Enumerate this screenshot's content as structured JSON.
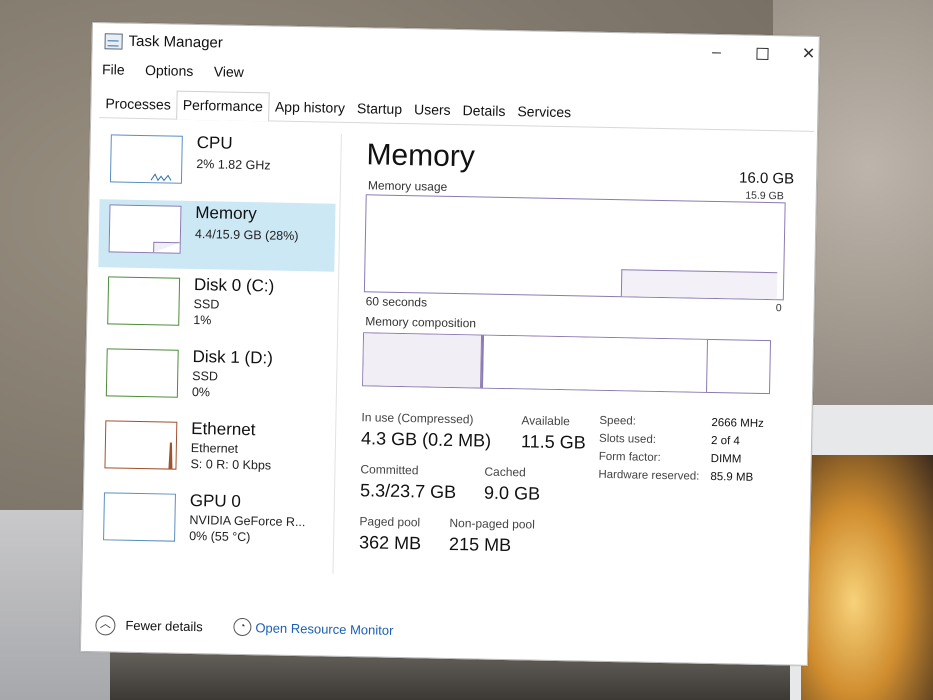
{
  "window": {
    "title": "Task Manager"
  },
  "menu": [
    "File",
    "Options",
    "View"
  ],
  "tabs": [
    "Processes",
    "Performance",
    "App history",
    "Startup",
    "Users",
    "Details",
    "Services"
  ],
  "active_tab": "Performance",
  "sidebar": [
    {
      "name": "CPU",
      "lines": [
        "2% 1.82 GHz"
      ]
    },
    {
      "name": "Memory",
      "lines": [
        "4.4/15.9 GB (28%)"
      ],
      "selected": true
    },
    {
      "name": "Disk 0 (C:)",
      "lines": [
        "SSD",
        "1%"
      ]
    },
    {
      "name": "Disk 1 (D:)",
      "lines": [
        "SSD",
        "0%"
      ]
    },
    {
      "name": "Ethernet",
      "lines": [
        "Ethernet",
        "S: 0 R: 0 Kbps"
      ]
    },
    {
      "name": "GPU 0",
      "lines": [
        "NVIDIA GeForce R...",
        "0% (55 °C)"
      ]
    }
  ],
  "main": {
    "title": "Memory",
    "total": "16.0 GB",
    "usage_label": "Memory usage",
    "usage_max": "15.9 GB",
    "time_label": "60 seconds",
    "zero": "0",
    "composition_label": "Memory composition",
    "stats": {
      "in_use_label": "In use (Compressed)",
      "in_use": "4.3 GB (0.2 MB)",
      "available_label": "Available",
      "available": "11.5 GB",
      "committed_label": "Committed",
      "committed": "5.3/23.7 GB",
      "cached_label": "Cached",
      "cached": "9.0 GB",
      "paged_label": "Paged pool",
      "paged": "362 MB",
      "nonpaged_label": "Non-paged pool",
      "nonpaged": "215 MB"
    },
    "specs": [
      {
        "label": "Speed:",
        "value": "2666 MHz"
      },
      {
        "label": "Slots used:",
        "value": "2 of 4"
      },
      {
        "label": "Form factor:",
        "value": "DIMM"
      },
      {
        "label": "Hardware reserved:",
        "value": "85.9 MB"
      }
    ]
  },
  "footer": {
    "fewer": "Fewer details",
    "resource_monitor": "Open Resource Monitor"
  },
  "colors": {
    "accent_purple": "#8b7bb1",
    "selected_bg": "#cce8f4",
    "link": "#1a5fb4"
  }
}
